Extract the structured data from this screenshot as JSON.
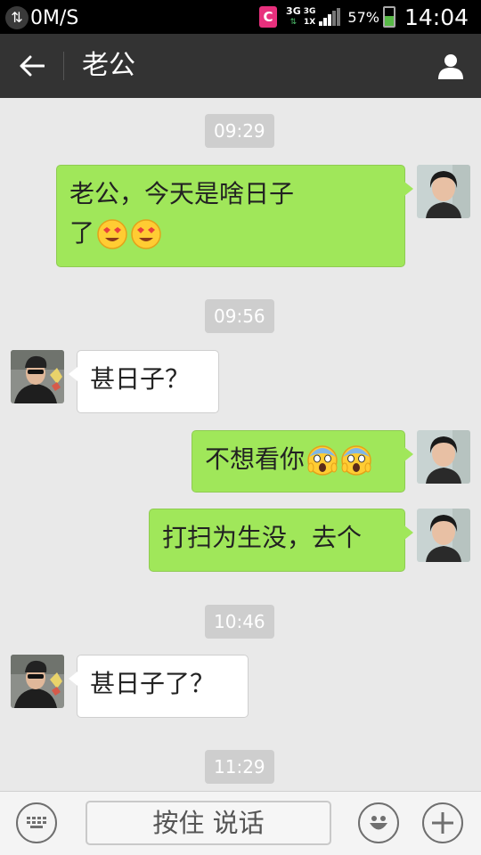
{
  "status_bar": {
    "net_speed": "0M/S",
    "app_badge": "C",
    "net_type_1": "3G",
    "net_type_2": "3G",
    "net_type_2_sub": "1X",
    "battery": "57%",
    "battery_level": 0.57,
    "time": "14:04"
  },
  "title_bar": {
    "title": "老公",
    "back_icon": "arrow-left-icon",
    "contact_icon": "person-icon"
  },
  "colors": {
    "outgoing_bubble": "#a0e75a",
    "incoming_bubble": "#ffffff",
    "title_bar": "#333333",
    "chat_bg": "#e9e9e9"
  },
  "messages": [
    {
      "type": "timestamp",
      "text": "09:29"
    },
    {
      "type": "outgoing",
      "line1": "老公，今天是啥日子",
      "line2": "了",
      "emoji": [
        "smiling-face-with-heart-eyes",
        "smiling-face-with-heart-eyes"
      ]
    },
    {
      "type": "timestamp",
      "text": "09:56"
    },
    {
      "type": "incoming",
      "text": "甚日子？"
    },
    {
      "type": "outgoing",
      "text": "不想看你",
      "emoji": [
        "face-screaming-in-fear",
        "face-screaming-in-fear"
      ]
    },
    {
      "type": "outgoing",
      "text": "打扫为生没，去个"
    },
    {
      "type": "timestamp",
      "text": "10:46"
    },
    {
      "type": "incoming",
      "text": "甚日子了？"
    },
    {
      "type": "timestamp",
      "text": "11:29"
    }
  ],
  "bottom_bar": {
    "keyboard_icon": "keyboard-icon",
    "voice_button": "按住 说话",
    "emoji_icon": "smiley-icon",
    "plus_icon": "plus-icon"
  }
}
